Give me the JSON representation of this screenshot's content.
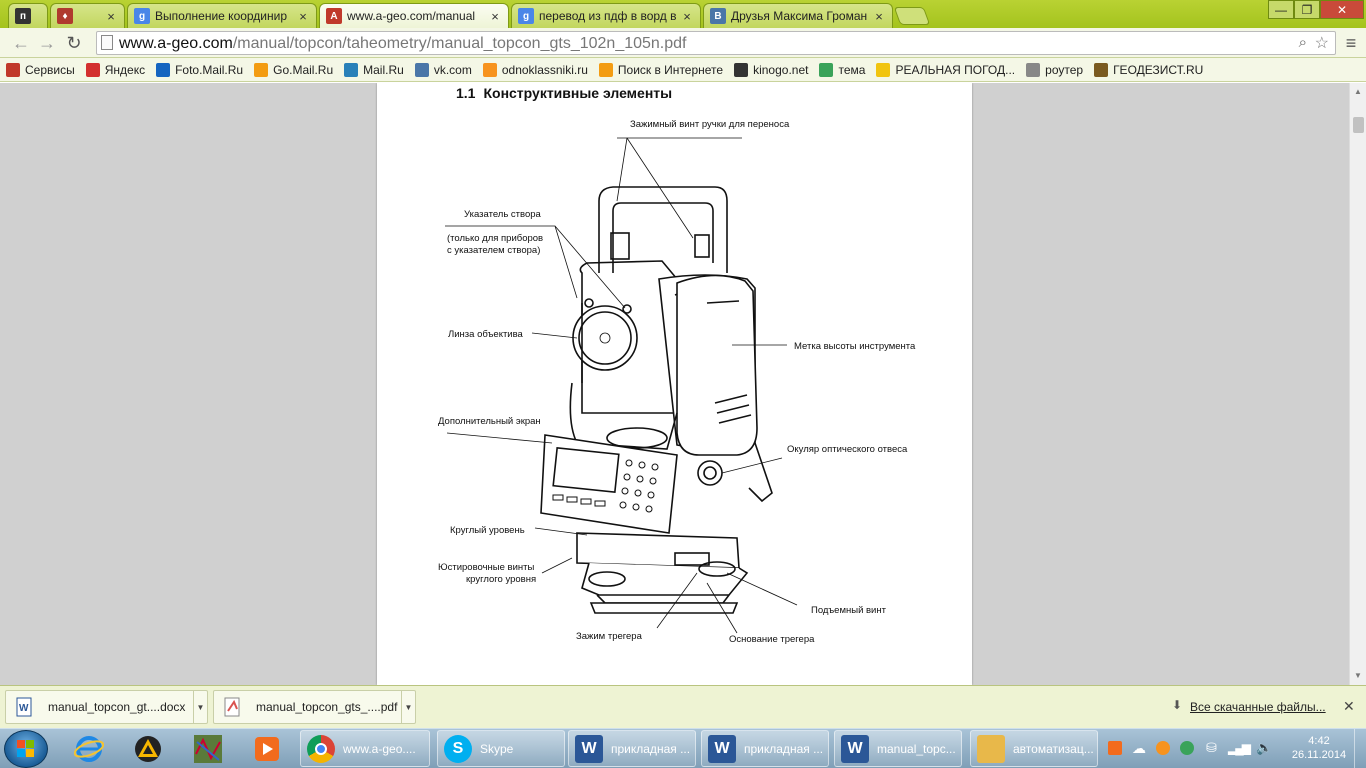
{
  "browser": {
    "tabs": [
      {
        "title": "",
        "icon": "page-icon"
      },
      {
        "title": "",
        "icon": "shield-icon"
      },
      {
        "title": "Выполнение координир",
        "icon": "google-icon"
      },
      {
        "title": "www.a-geo.com/manual",
        "icon": "ageo-icon",
        "active": true
      },
      {
        "title": "перевод из пдф в ворд в",
        "icon": "google-icon"
      },
      {
        "title": "Друзья Максима Громан",
        "icon": "vk-icon"
      }
    ],
    "address": {
      "domain": "www.a-geo.com",
      "path": "/manual/topcon/taheometry/manual_topcon_gts_102n_105n.pdf"
    },
    "bookmarks": [
      {
        "label": "Сервисы",
        "color": "#c0392b"
      },
      {
        "label": "Яндекс",
        "color": "#d32f2f"
      },
      {
        "label": "Foto.Mail.Ru",
        "color": "#1565c0"
      },
      {
        "label": "Go.Mail.Ru",
        "color": "#f39c12"
      },
      {
        "label": "Mail.Ru",
        "color": "#2980b9"
      },
      {
        "label": "vk.com",
        "color": "#4a76a8"
      },
      {
        "label": "odnoklassniki.ru",
        "color": "#f7931e"
      },
      {
        "label": "Поиск в Интернете",
        "color": "#f39c12"
      },
      {
        "label": "kinogo.net",
        "color": "#333333"
      },
      {
        "label": "тема",
        "color": "#3aa35a"
      },
      {
        "label": "РЕАЛЬНАЯ ПОГОД...",
        "color": "#f1c40f"
      },
      {
        "label": "роутер",
        "color": "#888888"
      },
      {
        "label": "ГЕОДЕЗИСТ.RU",
        "color": "#7a5a20"
      }
    ]
  },
  "document": {
    "section_number": "1.1",
    "section_title": "Конструктивные элементы",
    "labels": {
      "handle_screw": "Зажимный винт ручки для переноса",
      "sight_pointer": "Указатель створа",
      "sight_note_1": "(только для приборов",
      "sight_note_2": "с указателем створа)",
      "objective_lens": "Линза объектива",
      "height_mark": "Метка высоты инструмента",
      "extra_display": "Дополнительный экран",
      "plummet_eyepiece": "Окуляр оптического отвеса",
      "circular_level": "Круглый уровень",
      "adjust_screws_1": "Юстировочные винты",
      "adjust_screws_2": "круглого уровня",
      "leveling_screw": "Подъемный винт",
      "tribrach_clamp": "Зажим трегера",
      "tribrach_base": "Основание трегера"
    }
  },
  "downloads": {
    "items": [
      {
        "name": "manual_topcon_gt....docx",
        "icon": "word-doc-icon"
      },
      {
        "name": "manual_topcon_gts_....pdf",
        "icon": "pdf-file-icon"
      }
    ],
    "show_all": "Все скачанные файлы..."
  },
  "taskbar": {
    "tasks": [
      {
        "label": "www.a-geo....",
        "icon": "chrome-icon",
        "color": "#ffffff"
      },
      {
        "label": "Skype",
        "icon": "skype-icon",
        "color": "#00aff0"
      },
      {
        "label": "прикладная ...",
        "icon": "word-icon",
        "color": "#2b5797"
      },
      {
        "label": "прикладная ...",
        "icon": "word-icon",
        "color": "#2b5797"
      },
      {
        "label": "manual_topc...",
        "icon": "word-icon",
        "color": "#2b5797"
      },
      {
        "label": "автоматизац...",
        "icon": "folder-icon",
        "color": "#e8b84a"
      }
    ],
    "time": "4:42",
    "date": "26.11.2014"
  }
}
